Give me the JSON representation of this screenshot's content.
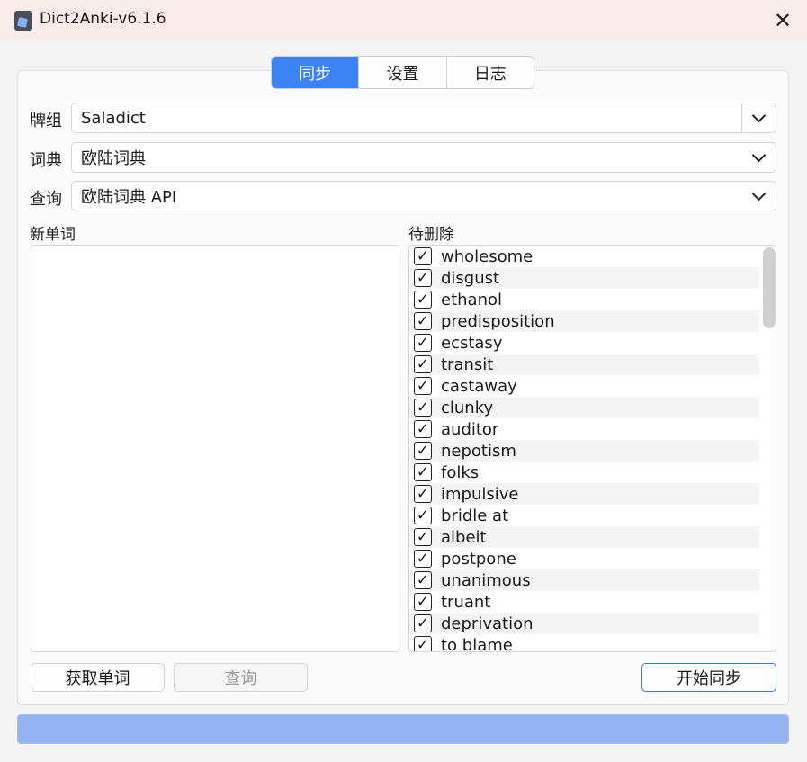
{
  "window": {
    "title": "Dict2Anki-v6.1.6",
    "close_glyph": "✕"
  },
  "tabs": [
    {
      "label": "同步",
      "active": true
    },
    {
      "label": "设置",
      "active": false
    },
    {
      "label": "日志",
      "active": false
    }
  ],
  "deck": {
    "label": "牌组",
    "value": "Saladict"
  },
  "dictionary": {
    "label": "词典",
    "value": "欧陆词典"
  },
  "query": {
    "label": "查询",
    "value": "欧陆词典 API"
  },
  "new_words": {
    "label": "新单词",
    "items": []
  },
  "to_delete": {
    "label": "待删除",
    "check_glyph": "✓",
    "items": [
      "wholesome",
      "disgust",
      "ethanol",
      "predisposition",
      "ecstasy",
      "transit",
      "castaway",
      "clunky",
      "auditor",
      "nepotism",
      "folks",
      "impulsive",
      "bridle at",
      "albeit",
      "postpone",
      "unanimous",
      "truant",
      "deprivation",
      "to blame"
    ]
  },
  "buttons": {
    "fetch_words": "获取单词",
    "query": "查询",
    "start_sync": "开始同步"
  },
  "progress": {
    "value": 100
  },
  "colors": {
    "accent": "#3b82f6",
    "progress_fill": "#93b3f3"
  }
}
